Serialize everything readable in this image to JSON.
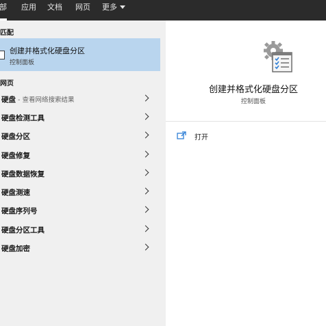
{
  "tabs": [
    {
      "label": "部"
    },
    {
      "label": "应用"
    },
    {
      "label": "文档"
    },
    {
      "label": "网页"
    },
    {
      "label": "更多"
    }
  ],
  "best_match": {
    "section_title": "匹配",
    "title": "创建并格式化硬盘分区",
    "subtitle": "控制面板"
  },
  "web": {
    "section_title": "网页",
    "items": [
      {
        "label": "硬盘",
        "hint": " - 查看网络搜索结果"
      },
      {
        "label": "硬盘检测工具"
      },
      {
        "label": "硬盘分区"
      },
      {
        "label": "硬盘修复"
      },
      {
        "label": "硬盘数据恢复"
      },
      {
        "label": "硬盘测速"
      },
      {
        "label": "硬盘序列号"
      },
      {
        "label": "硬盘分区工具"
      },
      {
        "label": "硬盘加密"
      }
    ]
  },
  "preview": {
    "title": "创建并格式化硬盘分区",
    "subtitle": "控制面板",
    "icon": "control-panel-settings-icon",
    "open_label": "打开"
  },
  "colors": {
    "topbar": "#2b2b2b",
    "selected": "#b9d5ee",
    "pane_bg": "#f0f0f0"
  }
}
